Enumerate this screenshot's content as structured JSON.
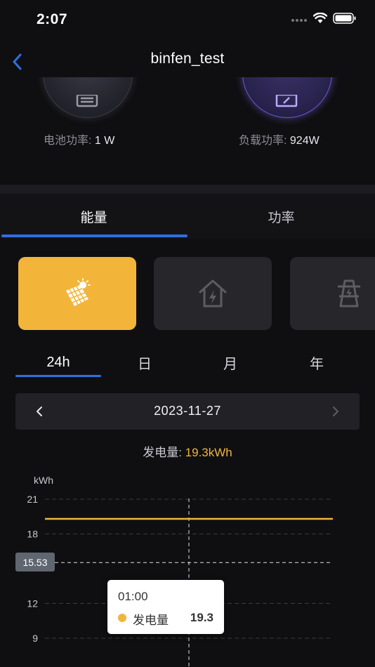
{
  "status_bar": {
    "time": "2:07"
  },
  "nav": {
    "title": "binfen_test"
  },
  "flow": {
    "battery": {
      "label": "电池功率: ",
      "value": "1 W"
    },
    "load": {
      "label": "负载功率: ",
      "value": "924W"
    }
  },
  "main_tabs": [
    {
      "label": "能量"
    },
    {
      "label": "功率"
    }
  ],
  "device_cards": [
    {
      "icon": "solar-panel-icon",
      "selected": true
    },
    {
      "icon": "home-power-icon",
      "selected": false
    },
    {
      "icon": "power-tower-icon",
      "selected": false
    }
  ],
  "period_tabs": [
    {
      "label": "24h"
    },
    {
      "label": "日"
    },
    {
      "label": "月"
    },
    {
      "label": "年"
    }
  ],
  "date_selector": {
    "date": "2023-11-27"
  },
  "summary": {
    "label": "发电量: ",
    "value": "19.3kWh"
  },
  "colors": {
    "accent": "#2f6fe0",
    "solar": "#f2b53a",
    "background": "#0f0f11"
  },
  "chart_data": {
    "type": "line",
    "ylabel": "kWh",
    "y_ticks": [
      21,
      18,
      12,
      9
    ],
    "ylim": [
      6,
      21
    ],
    "series": [
      {
        "name": "发电量",
        "values": [
          19.3,
          19.3,
          19.3,
          19.3,
          19.3
        ]
      }
    ],
    "crosshair_value": "15.53",
    "tooltip": {
      "time": "01:00",
      "series": "发电量",
      "value": "19.3"
    }
  }
}
